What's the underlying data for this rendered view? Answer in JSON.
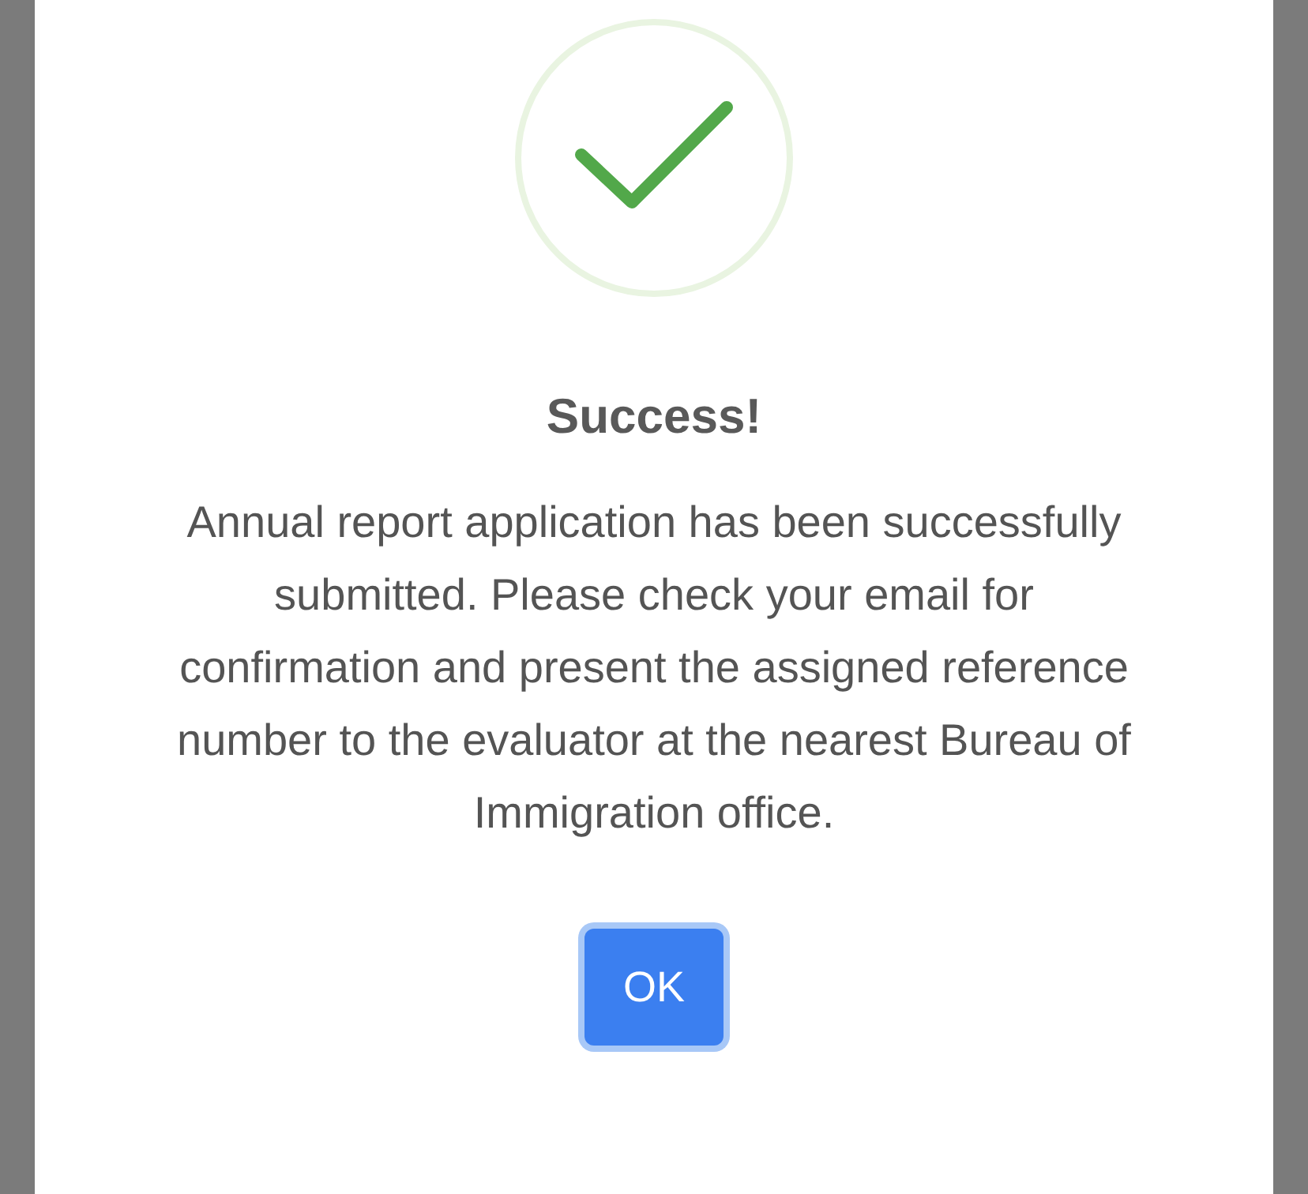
{
  "dialog": {
    "title": "Success!",
    "message": "Annual report application has been successfully submitted. Please check your email for confirmation and present the assigned reference number to the evaluator at the nearest Bureau of Immigration office.",
    "buttons": [
      {
        "label": "OK"
      }
    ]
  }
}
